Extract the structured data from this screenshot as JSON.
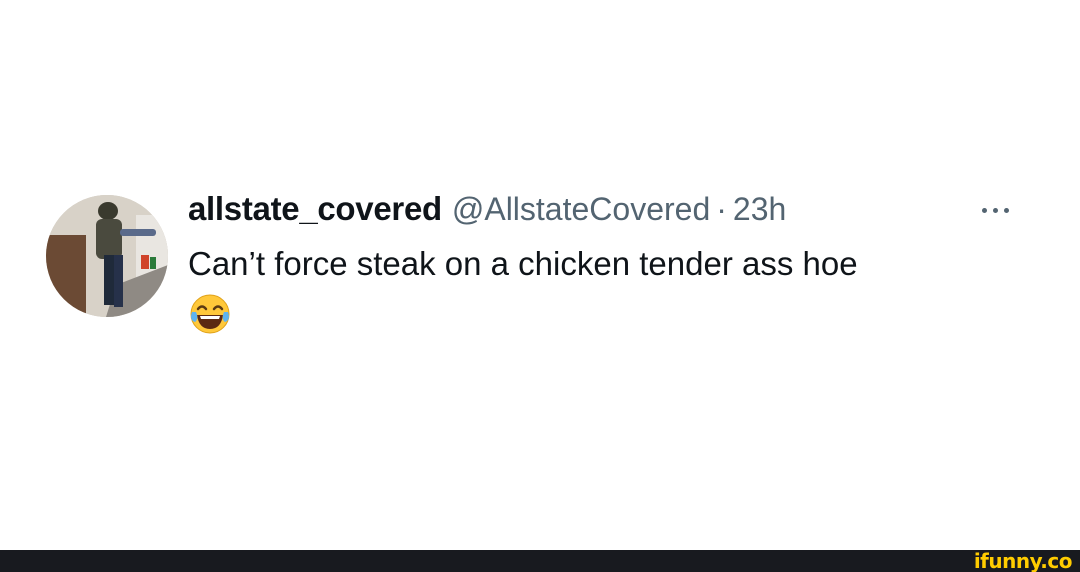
{
  "tweet": {
    "display_name": "allstate_covered",
    "handle": "@AllstateCovered",
    "separator": "·",
    "time": "23h",
    "text": "Can’t force steak on a chicken tender ass hoe",
    "emoji": "face-with-tears-of-joy",
    "more_icon": "more-horizontal-icon"
  },
  "watermark": {
    "text": "ifunny.co"
  },
  "colors": {
    "text_primary": "#0f1419",
    "text_secondary": "#536471",
    "footer_bg": "#181a1f",
    "watermark": "#ffcc00"
  }
}
